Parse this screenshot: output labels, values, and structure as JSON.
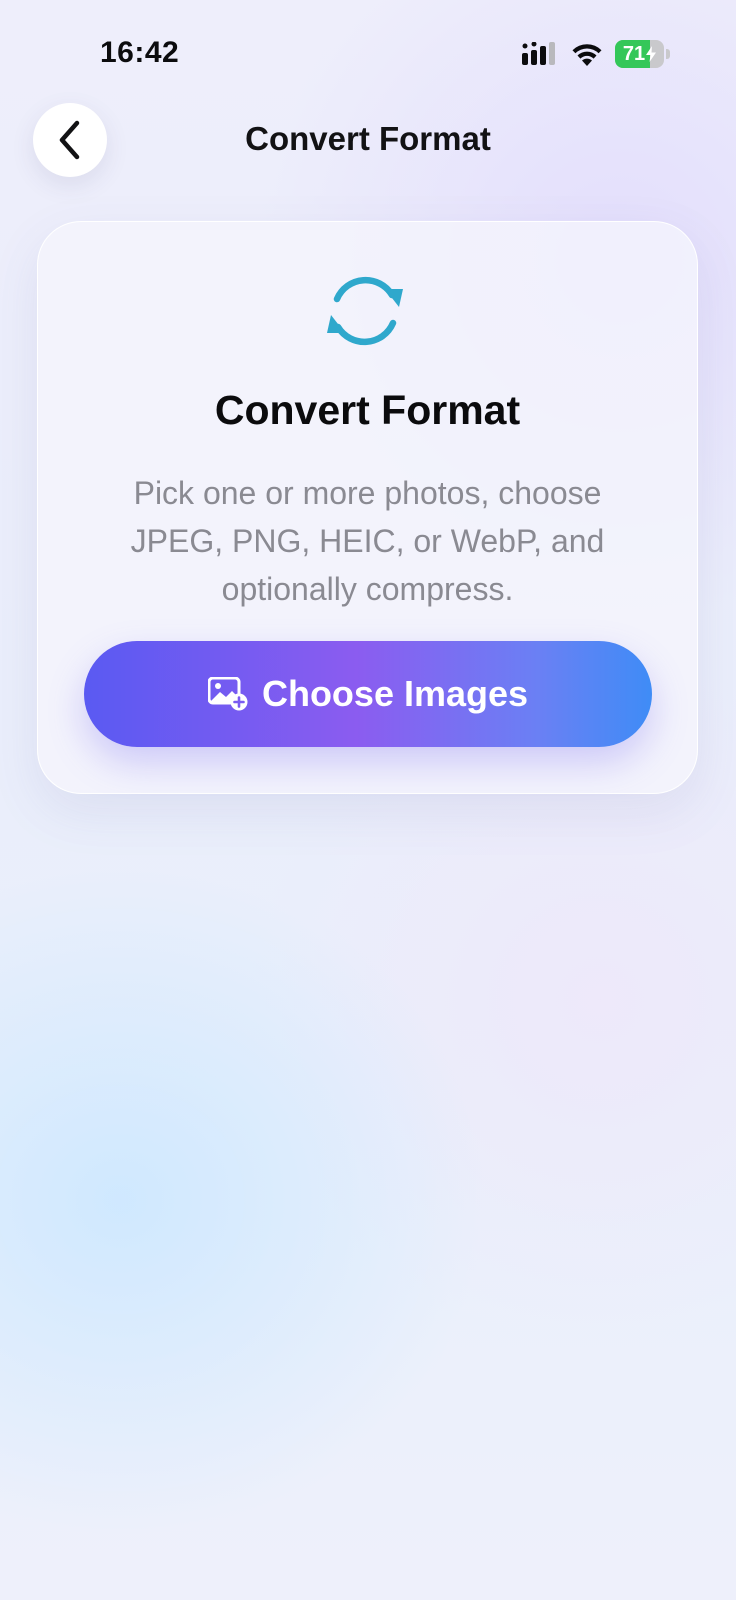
{
  "status_bar": {
    "time": "16:42",
    "battery_level": "71",
    "battery_fraction": 0.71,
    "icons": [
      "cellular-signal-icon",
      "wifi-icon",
      "battery-charging-icon"
    ]
  },
  "nav": {
    "title": "Convert Format",
    "back_icon": "chevron-left-icon"
  },
  "card": {
    "icon": "convert-arrows-icon",
    "title": "Convert Format",
    "description": "Pick one or more photos, choose JPEG, PNG, HEIC, or WebP, and optionally compress.",
    "button_label": "Choose Images",
    "button_icon": "photo-add-icon"
  },
  "colors": {
    "accent_teal": "#2fa8cc",
    "button_gradient_start": "#5a5af2",
    "button_gradient_mid": "#8b5cf0",
    "button_gradient_end": "#3f8cf6",
    "battery_green": "#34c759"
  }
}
